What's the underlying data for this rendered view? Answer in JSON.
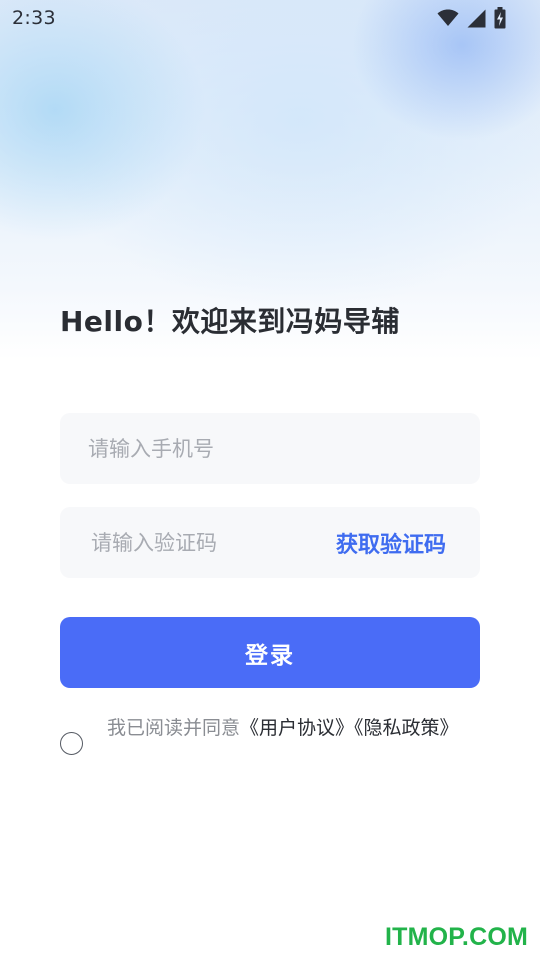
{
  "status_bar": {
    "time": "2:33",
    "icons": [
      "wifi-icon",
      "cellular-signal-icon",
      "battery-charging-icon"
    ]
  },
  "welcome": {
    "title": "Hello！欢迎来到冯妈导辅"
  },
  "phone_input": {
    "value": "",
    "placeholder": "请输入手机号"
  },
  "code_input": {
    "value": "",
    "placeholder": "请输入验证码",
    "get_code_label": "获取验证码"
  },
  "login": {
    "label": "登录"
  },
  "agreement": {
    "checked": false,
    "prefix": "我已阅读并同意",
    "user_agreement": "《用户协议》",
    "privacy_policy": "《隐私政策》"
  },
  "watermark": {
    "text": "ITMOP.COM"
  },
  "colors": {
    "primary": "#4a6cf7",
    "link": "#3f6cf0",
    "input_bg": "#f7f8fa",
    "watermark": "#22b34a"
  }
}
